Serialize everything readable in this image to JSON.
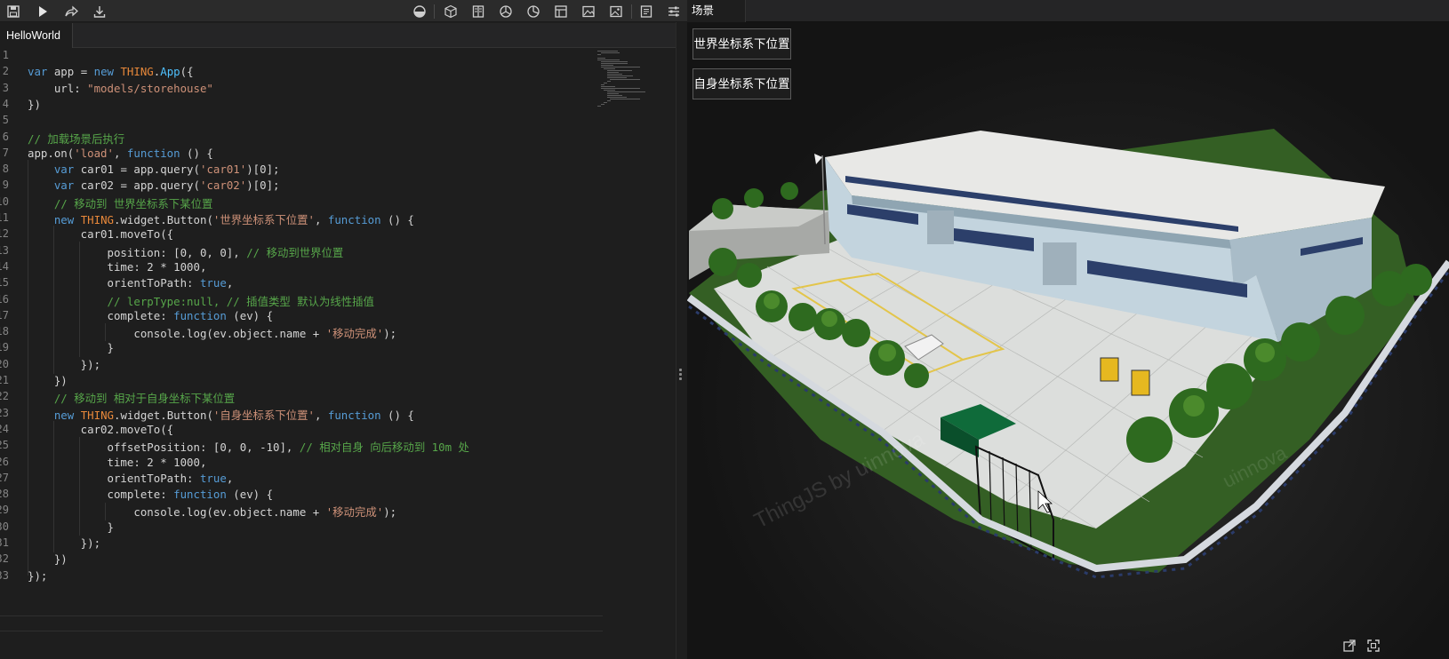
{
  "toolbar": {
    "left_icons": [
      "save-icon",
      "run-icon",
      "share-icon",
      "download-icon"
    ],
    "right_icons": [
      "theme-icon",
      "cube-icon",
      "book-icon",
      "dashboard-icon",
      "pie-chart-icon",
      "layout-icon",
      "image-icon",
      "picture-icon",
      "notes-icon",
      "settings-icon"
    ]
  },
  "editor": {
    "tab_label": "HelloWorld",
    "gutter_numbers": [
      "1",
      "2",
      "3",
      "4",
      "5",
      "6",
      "7",
      "8",
      "9",
      "10",
      "11",
      "12",
      "13",
      "14",
      "15",
      "16",
      "17",
      "18",
      "19",
      "20",
      "21",
      "22",
      "23",
      "24",
      "25",
      "26",
      "27",
      "28",
      "29",
      "30",
      "31",
      "32",
      "33"
    ],
    "code_lines": [
      [],
      [
        [
          "kw",
          "var"
        ],
        [
          "txt",
          " app = "
        ],
        [
          "kw",
          "new"
        ],
        [
          "txt",
          " "
        ],
        [
          "cls",
          "THING"
        ],
        [
          "txt",
          "."
        ],
        [
          "fn",
          "App"
        ],
        [
          "txt",
          "({"
        ]
      ],
      [
        [
          "txt",
          "    url: "
        ],
        [
          "str",
          "\"models/storehouse\""
        ]
      ],
      [
        [
          "txt",
          "})"
        ]
      ],
      [],
      [
        [
          "cm",
          "// 加载场景后执行"
        ]
      ],
      [
        [
          "txt",
          "app.on("
        ],
        [
          "str",
          "'load'"
        ],
        [
          "txt",
          ", "
        ],
        [
          "kw",
          "function"
        ],
        [
          "txt",
          " () {"
        ]
      ],
      [
        [
          "txt",
          "    "
        ],
        [
          "kw",
          "var"
        ],
        [
          "txt",
          " car01 = app.query("
        ],
        [
          "str",
          "'car01'"
        ],
        [
          "txt",
          ")[0];"
        ]
      ],
      [
        [
          "txt",
          "    "
        ],
        [
          "kw",
          "var"
        ],
        [
          "txt",
          " car02 = app.query("
        ],
        [
          "str",
          "'car02'"
        ],
        [
          "txt",
          ")[0];"
        ]
      ],
      [
        [
          "txt",
          "    "
        ],
        [
          "cm",
          "// 移动到 世界坐标系下某位置"
        ]
      ],
      [
        [
          "txt",
          "    "
        ],
        [
          "kw",
          "new"
        ],
        [
          "txt",
          " "
        ],
        [
          "cls",
          "THING"
        ],
        [
          "txt",
          ".widget.Button("
        ],
        [
          "str",
          "'世界坐标系下位置'"
        ],
        [
          "txt",
          ", "
        ],
        [
          "kw",
          "function"
        ],
        [
          "txt",
          " () {"
        ]
      ],
      [
        [
          "txt",
          "        car01.moveTo({"
        ]
      ],
      [
        [
          "txt",
          "            position: [0, 0, 0], "
        ],
        [
          "cm",
          "// 移动到世界位置"
        ]
      ],
      [
        [
          "txt",
          "            time: 2 * 1000,"
        ]
      ],
      [
        [
          "txt",
          "            orientToPath: "
        ],
        [
          "kw",
          "true"
        ],
        [
          "txt",
          ","
        ]
      ],
      [
        [
          "txt",
          "            "
        ],
        [
          "cm",
          "// lerpType:null, // 插值类型 默认为线性插值"
        ]
      ],
      [
        [
          "txt",
          "            complete: "
        ],
        [
          "kw",
          "function"
        ],
        [
          "txt",
          " (ev) {"
        ]
      ],
      [
        [
          "txt",
          "                console.log(ev.object.name + "
        ],
        [
          "str",
          "'移动完成'"
        ],
        [
          "txt",
          ");"
        ]
      ],
      [
        [
          "txt",
          "            }"
        ]
      ],
      [
        [
          "txt",
          "        });"
        ]
      ],
      [
        [
          "txt",
          "    })"
        ]
      ],
      [
        [
          "txt",
          "    "
        ],
        [
          "cm",
          "// 移动到 相对于自身坐标下某位置"
        ]
      ],
      [
        [
          "txt",
          "    "
        ],
        [
          "kw",
          "new"
        ],
        [
          "txt",
          " "
        ],
        [
          "cls",
          "THING"
        ],
        [
          "txt",
          ".widget.Button("
        ],
        [
          "str",
          "'自身坐标系下位置'"
        ],
        [
          "txt",
          ", "
        ],
        [
          "kw",
          "function"
        ],
        [
          "txt",
          " () {"
        ]
      ],
      [
        [
          "txt",
          "        car02.moveTo({"
        ]
      ],
      [
        [
          "txt",
          "            offsetPosition: [0, 0, -10], "
        ],
        [
          "cm",
          "// 相对自身 向后移动到 10m 处"
        ]
      ],
      [
        [
          "txt",
          "            time: 2 * 1000,"
        ]
      ],
      [
        [
          "txt",
          "            orientToPath: "
        ],
        [
          "kw",
          "true"
        ],
        [
          "txt",
          ","
        ]
      ],
      [
        [
          "txt",
          "            complete: "
        ],
        [
          "kw",
          "function"
        ],
        [
          "txt",
          " (ev) {"
        ]
      ],
      [
        [
          "txt",
          "                console.log(ev.object.name + "
        ],
        [
          "str",
          "'移动完成'"
        ],
        [
          "txt",
          ");"
        ]
      ],
      [
        [
          "txt",
          "            }"
        ]
      ],
      [
        [
          "txt",
          "        });"
        ]
      ],
      [
        [
          "txt",
          "    })"
        ]
      ],
      [
        [
          "txt",
          "});"
        ]
      ]
    ]
  },
  "scene": {
    "tab_label": "场景",
    "button_world": "世界坐标系下位置",
    "button_local": "自身坐标系下位置",
    "watermark": "ThingJS by uinnova",
    "watermark_partial": "uinnova",
    "corner_icons": [
      "external-link-icon",
      "fullscreen-icon"
    ]
  },
  "colors": {
    "keyword": "#569cd6",
    "class": "#e8883a",
    "function": "#4fc1ff",
    "string": "#ce9178",
    "comment": "#57a64a",
    "text": "#d4d4d4"
  }
}
